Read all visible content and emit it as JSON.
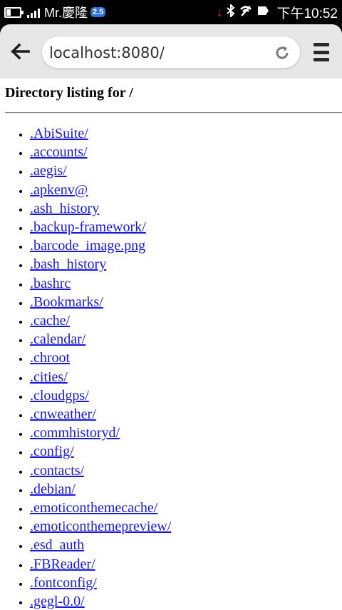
{
  "status_bar": {
    "carrier": "Mr.慶隆",
    "badge": "2.5",
    "time": "下午10:52",
    "icons": [
      "battery-icon",
      "signal-icon",
      "download-arrow-icon",
      "bluetooth-icon",
      "wifi-off-icon",
      "notification-icon"
    ],
    "download_color": "#e23030"
  },
  "browser": {
    "url": "localhost:8080/"
  },
  "page": {
    "heading": "Directory listing for /",
    "entries": [
      ".AbiSuite/",
      ".accounts/",
      ".aegis/",
      ".apkenv@",
      ".ash_history",
      ".backup-framework/",
      ".barcode_image.png",
      ".bash_history",
      ".bashrc",
      ".Bookmarks/",
      ".cache/",
      ".calendar/",
      ".chroot",
      ".cities/",
      ".cloudgps/",
      ".cnweather/",
      ".commhistoryd/",
      ".config/",
      ".contacts/",
      ".debian/",
      ".emoticonthemecache/",
      ".emoticonthemepreview/",
      ".esd_auth",
      ".FBReader/",
      ".fontconfig/",
      ".gegl-0.0/"
    ],
    "link_color": "#1a1adb"
  }
}
